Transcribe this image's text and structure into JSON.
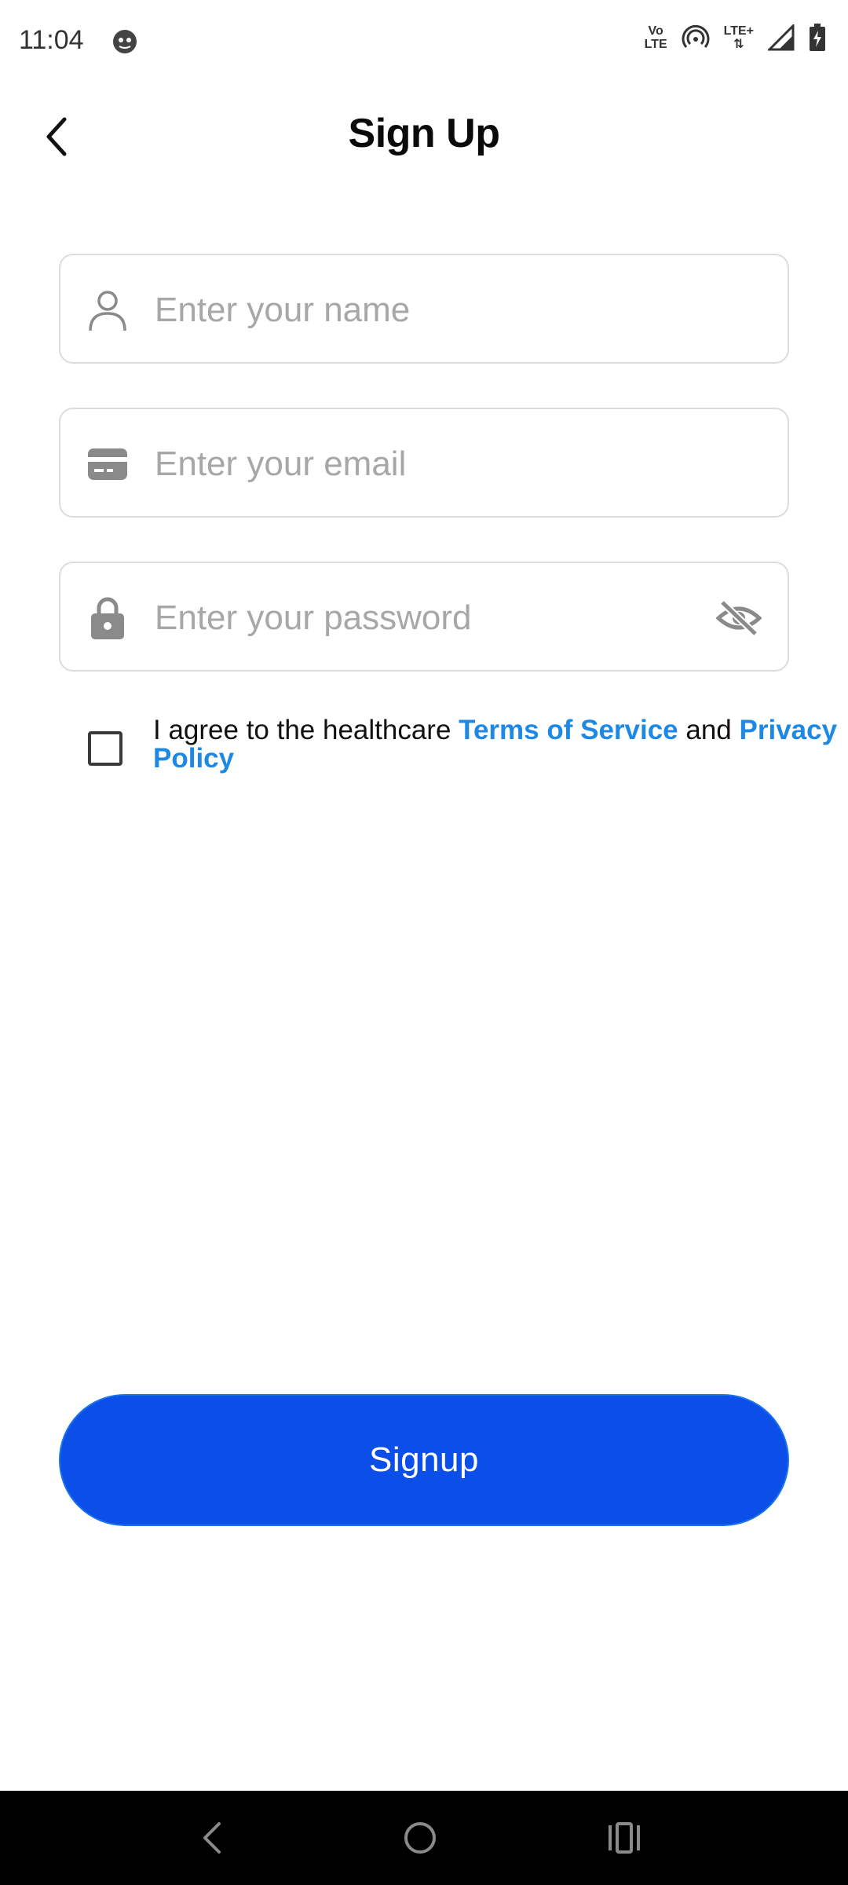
{
  "status_bar": {
    "time": "11:04",
    "volte_line1": "Vo",
    "volte_line2": "LTE",
    "lte_plus": "LTE+"
  },
  "header": {
    "title": "Sign Up"
  },
  "form": {
    "name_placeholder": "Enter your name",
    "email_placeholder": "Enter your email",
    "password_placeholder": "Enter your password"
  },
  "agreement": {
    "text_before": "I agree to the healthcare ",
    "terms_link": "Terms of Service",
    "text_middle": " and ",
    "privacy_link": "Privacy Policy",
    "checked": false
  },
  "signup_button": {
    "label": "Signup"
  },
  "colors": {
    "primary": "#0b4fe8",
    "link": "#1e88e5",
    "placeholder": "#a7a7a7",
    "border": "#dcdcdc"
  },
  "icons": {
    "back": "chevron-left-icon",
    "name": "person-icon",
    "email": "card-icon",
    "password": "lock-icon",
    "visibility": "eye-off-icon"
  }
}
